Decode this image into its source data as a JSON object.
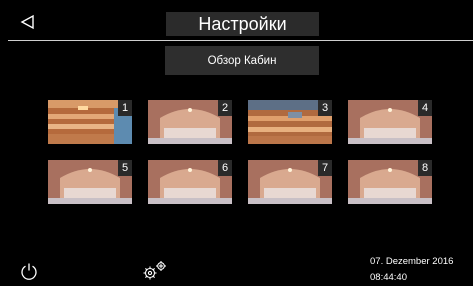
{
  "header": {
    "back_icon": "back-triangle-icon",
    "title": "Настройки"
  },
  "section": {
    "button_label": "Обзор Кабин"
  },
  "cabins": [
    {
      "number": "1",
      "scene": "sauna"
    },
    {
      "number": "2",
      "scene": "steam-bath"
    },
    {
      "number": "3",
      "scene": "sauna"
    },
    {
      "number": "4",
      "scene": "steam-bath"
    },
    {
      "number": "5",
      "scene": "steam-bath"
    },
    {
      "number": "6",
      "scene": "steam-bath"
    },
    {
      "number": "7",
      "scene": "steam-bath"
    },
    {
      "number": "8",
      "scene": "steam-bath"
    }
  ],
  "footer": {
    "power_icon": "power-icon",
    "settings_icon": "gears-icon",
    "date": "07. Dezember 2016",
    "time": "08:44:40"
  },
  "colors": {
    "background": "#000000",
    "title_bg": "#2b2b2b",
    "divider": "#cfcfcf"
  }
}
